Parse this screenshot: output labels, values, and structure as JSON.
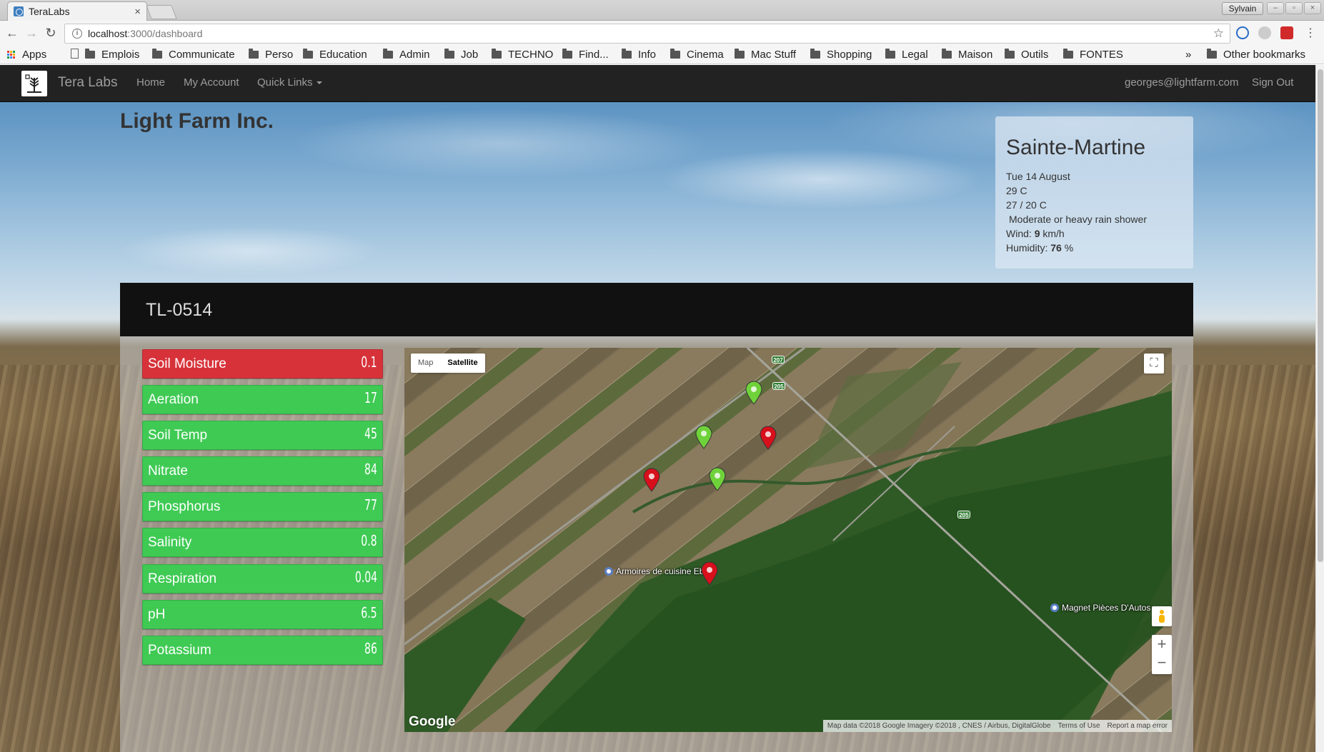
{
  "browser": {
    "tab_title": "TeraLabs",
    "tab_close": "×",
    "profile_name": "Sylvain",
    "url_host": "localhost",
    "url_path": ":3000/dashboard",
    "bookmarks": [
      "Apps",
      "Emplois",
      "Communicate",
      "Perso",
      "Education",
      "Admin",
      "Job",
      "TECHNO",
      "Find...",
      "Info",
      "Cinema",
      "Mac Stuff",
      "Shopping",
      "Legal",
      "Maison",
      "Outils",
      "FONTES"
    ],
    "overflow": "»",
    "other_bookmarks": "Other bookmarks"
  },
  "navbar": {
    "brand": "Tera Labs",
    "links": [
      "Home",
      "My Account",
      "Quick Links"
    ],
    "user_email": "georges@lightfarm.com",
    "sign_out": "Sign Out"
  },
  "company": "Light Farm Inc.",
  "weather": {
    "city": "Sainte-Martine",
    "date": "Tue 14 August",
    "temp": "29 C",
    "range": "27 / 20 C",
    "condition": "Moderate or heavy rain shower",
    "wind_label": "Wind:",
    "wind_value": "9",
    "wind_unit": "km/h",
    "humidity_label": "Humidity:",
    "humidity_value": "76",
    "humidity_unit": "%"
  },
  "device": {
    "id": "TL-0514",
    "sensors": [
      {
        "label": "Soil Moisture",
        "value": "0.1",
        "status": "alert"
      },
      {
        "label": "Aeration",
        "value": "17",
        "status": "ok"
      },
      {
        "label": "Soil Temp",
        "value": "45",
        "status": "ok"
      },
      {
        "label": "Nitrate",
        "value": "84",
        "status": "ok"
      },
      {
        "label": "Phosphorus",
        "value": "77",
        "status": "ok"
      },
      {
        "label": "Salinity",
        "value": "0.8",
        "status": "ok"
      },
      {
        "label": "Respiration",
        "value": "0.04",
        "status": "ok"
      },
      {
        "label": "pH",
        "value": "6.5",
        "status": "ok"
      },
      {
        "label": "Potassium",
        "value": "86",
        "status": "ok"
      }
    ]
  },
  "map": {
    "type_map": "Map",
    "type_satellite": "Satellite",
    "places": [
      "Armoires de cuisine Ebsu",
      "Magnet Pièces D'Autos"
    ],
    "route_shields": [
      "207",
      "205",
      "205"
    ],
    "google": "Google",
    "attribution": "Map data ©2018 Google Imagery ©2018 , CNES / Airbus, DigitalGlobe",
    "terms": "Terms of Use",
    "report": "Report a map error",
    "zoom_in": "+",
    "zoom_out": "−",
    "markers": [
      {
        "color": "green",
        "status": "ok"
      },
      {
        "color": "green",
        "status": "ok"
      },
      {
        "color": "red",
        "status": "alert"
      },
      {
        "color": "green",
        "status": "ok"
      },
      {
        "color": "red",
        "status": "alert"
      },
      {
        "color": "red",
        "status": "alert"
      }
    ]
  },
  "colors": {
    "ok": "#3fca54",
    "alert": "#d7323a",
    "navbar": "#222222"
  }
}
